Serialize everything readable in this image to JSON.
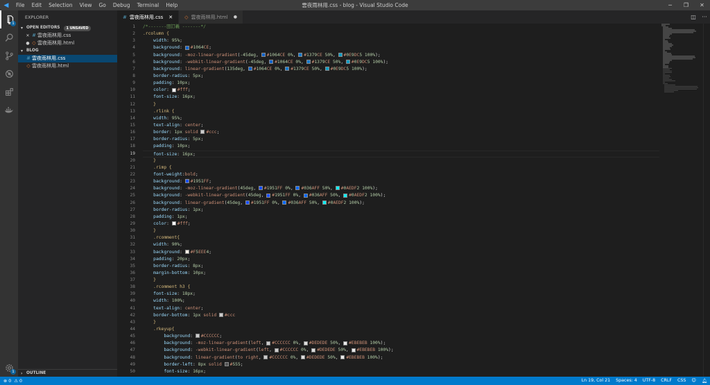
{
  "titlebar": {
    "menu": [
      "File",
      "Edit",
      "Selection",
      "View",
      "Go",
      "Debug",
      "Terminal",
      "Help"
    ],
    "title": "雲夜雨林用.css - blog - Visual Studio Code"
  },
  "activity": {
    "explorer_badge": "1"
  },
  "sidebar": {
    "title": "EXPLORER",
    "open_editors": {
      "label": "OPEN EDITORS",
      "badge": "1 UNSAVED",
      "files": [
        {
          "name": "雲夜雨林用.css",
          "marker": "✕",
          "type": "css"
        },
        {
          "name": "雲夜雨林用.html",
          "marker": "●",
          "type": "html"
        }
      ]
    },
    "folder": {
      "label": "BLOG",
      "files": [
        {
          "name": "雲夜雨林用.css",
          "type": "css",
          "selected": true
        },
        {
          "name": "雲夜雨林用.html",
          "type": "html",
          "selected": false
        }
      ]
    },
    "outline_label": "OUTLINE"
  },
  "tabs": [
    {
      "name": "雲夜雨林用.css",
      "type": "css",
      "active": true,
      "suffix": "✕"
    },
    {
      "name": "雲夜雨林用.html",
      "type": "html",
      "active": false,
      "suffix": "●"
    }
  ],
  "editor": {
    "current_line": 19,
    "lines": [
      "/*-------田訂義 -------*/",
      ".rcolumn {",
      "    width: 95%;",
      "    background: [#1064CE]#1064CE;",
      "    background: -moz-linear-gradient(-45deg, [#1064CE]#1064CE 0%, [#1379CE]#1379CE 50%, [#0E9DC5]#0E9DC5 100%);",
      "    background: -webkit-linear-gradient(-45deg, [#1064CE]#1064CE 0%, [#1379CE]#1379CE 50%, [#0E9DC5]#0E9DC5 100%);",
      "    background: linear-gradient(135deg, [#1064CE]#1064CE 0%, [#1379CE]#1379CE 50%, [#0E9DC5]#0E9DC5 100%);",
      "    border-radius: 5px;",
      "    padding: 10px;",
      "    color: [#ffffff]#fff;",
      "    font-size: 16px;",
      "    }",
      "    .rlink {",
      "    width: 95%;",
      "    text-align: center;",
      "    border: 1px solid [#cccccc]#ccc;",
      "    border-radius: 5px;",
      "    padding: 10px;",
      "    font-size: 16px;",
      "    }",
      "    .rimp {",
      "    font-weight:bold;",
      "    background: [#1951FF]#1951FF;",
      "    background: -moz-linear-gradient(45deg, [#1951FF]#1951FF 0%, [#036AFF]#036AFF 50%, [#0AEDF2]#0AEDF2 100%);",
      "    background: -webkit-linear-gradient(45deg, [#1951FF]#1951FF 0%, [#036AFF]#036AFF 50%, [#0AEDF2]#0AEDF2 100%);",
      "    background: linear-gradient(45deg, [#1951FF]#1951FF 0%, [#036AFF]#036AFF 50%, [#0AEDF2]#0AEDF2 100%);",
      "    border-radius: 1px;",
      "    padding: 1px;",
      "    color: [#ffffff]#fff;",
      "    }",
      "    .rcomment{",
      "    width: 90%;",
      "    background: [#F5EEE4]#F5EEE4;",
      "    padding: 20px;",
      "    border-radius: 8px;",
      "    margin-bottom: 10px;",
      "    }",
      "    .rcomment h3 {",
      "    font-size: 18px;",
      "    width: 100%;",
      "    text-align: center;",
      "    border-bottom: 1px solid [#cccccc]#ccc",
      "    }",
      "    .rkeyup{",
      "        background: [#CCCCCC]#CCCCCC;",
      "        background: -moz-linear-gradient(left, [#CCCCCC]#CCCCCC 0%, [#DEDEDE]#DEDEDE 50%, [#EBEBEB]#EBEBEB 100%);",
      "        background: -webkit-linear-gradient(left, [#CCCCCC]#CCCCCC 0%, [#DEDEDE]#DEDEDE 50%, [#EBEBEB]#EBEBEB 100%);",
      "        background: linear-gradient(to right, [#CCCCCC]#CCCCCC 0%, [#DEDEDE]#DEDEDE 50%, [#EBEBEB]#EBEBEB 100%);",
      "        border-left: 8px solid [#555555]#555;",
      "        font-size: 16px;"
    ]
  },
  "statusbar": {
    "errors": "⊗ 0",
    "warnings": "⚠ 0",
    "position": "Ln 19, Col 21",
    "spaces": "Spaces: 4",
    "encoding": "UTF-8",
    "eol": "CRLF",
    "language": "CSS"
  },
  "colors": {
    "accent": "#007acc",
    "selector": "#d7ba7d",
    "property": "#9cdcfe",
    "value": "#ce9178",
    "number": "#b5cea8",
    "comment": "#6a9955",
    "punct": "#d4d4d4"
  }
}
